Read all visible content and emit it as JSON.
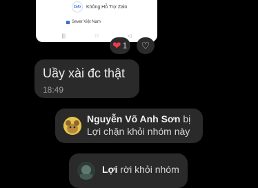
{
  "shared_image": {
    "title": "Không Hỗ Trợ Zalo",
    "badge": "Zalo",
    "subtitle": "Sever Việt Nam",
    "nav": [
      "|||",
      "□",
      "◁"
    ]
  },
  "reactions": {
    "count": "1",
    "heart_icon": "heart-icon",
    "add_icon": "heart-outline-icon"
  },
  "message": {
    "text": "Uầy xài đc thật",
    "time": "18:49"
  },
  "notices": [
    {
      "name": "Nguyễn Võ Anh Sơn",
      "line1_suffix": " bị",
      "line2": "Lợi chặn khỏi nhóm này"
    },
    {
      "name": "Lợi",
      "line1_suffix": " rời khỏi nhóm"
    }
  ],
  "colors": {
    "background": "#000000",
    "bubble": "#2a2a2a",
    "heart": "#f03b4e"
  }
}
